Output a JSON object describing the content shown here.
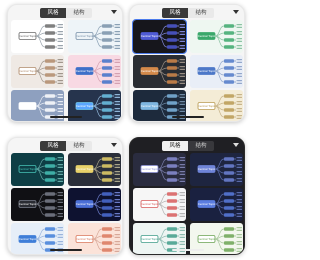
{
  "panels": [
    {
      "id": "top-left",
      "theme": "light",
      "tabs": [
        {
          "label": "风格",
          "active": true
        },
        {
          "label": "结构",
          "active": false
        }
      ],
      "thumbnails": [
        {
          "bg": "#ffffff",
          "accent": "#6a6a6a",
          "center": "#ffffff",
          "line": "#9aa4ad",
          "selected": false,
          "label": "Central Topic"
        },
        {
          "bg": "#eef4f8",
          "accent": "#7890a8",
          "center": "#eef4f8",
          "line": "#8aa0b4",
          "selected": false,
          "label": "Central Topic"
        },
        {
          "bg": "#efe9e4",
          "accent": "#b08a6a",
          "center": "#ffffff",
          "line": "#a0968c",
          "selected": false,
          "label": "Central Topic"
        },
        {
          "bg": "#f8d9e3",
          "accent": "#3e70c9",
          "center": "#3e70c9",
          "line": "#d4a0b0",
          "selected": false,
          "label": "Central Topic"
        },
        {
          "bg": "#8ea0bf",
          "accent": "#ffffff",
          "center": "#ffffff",
          "line": "#e8ecf4",
          "selected": false,
          "label": "Central Topic"
        },
        {
          "bg": "#26344d",
          "accent": "#6fc6e8",
          "center": "#5aa6ff",
          "line": "#8fb5d8",
          "selected": false,
          "label": "Central Topic"
        }
      ]
    },
    {
      "id": "top-right",
      "theme": "light",
      "tabs": [
        {
          "label": "风格",
          "active": true
        },
        {
          "label": "结构",
          "active": false
        }
      ],
      "thumbnails": [
        {
          "bg": "#16161c",
          "accent": "#4f5bd5",
          "center": "#4f5bd5",
          "line": "#7f86d8",
          "selected": true,
          "label": "Central Topic"
        },
        {
          "bg": "#eef7f1",
          "accent": "#3aa86b",
          "center": "#3aa86b",
          "line": "#8cc3a4",
          "selected": false,
          "label": "Central Topic"
        },
        {
          "bg": "#2a2d33",
          "accent": "#d48a4b",
          "center": "#d48a4b",
          "line": "#9a8f84",
          "selected": false,
          "label": "Central Topic"
        },
        {
          "bg": "#e9eef7",
          "accent": "#4d78c8",
          "center": "#4d78c8",
          "line": "#93a8cc",
          "selected": false,
          "label": "Central Topic"
        },
        {
          "bg": "#1d2a3c",
          "accent": "#7fb6e0",
          "center": "#7fb6e0",
          "line": "#6f8aa6",
          "selected": false,
          "label": "Central Topic"
        },
        {
          "bg": "#f4ecd6",
          "accent": "#b99a52",
          "center": "#ffffff",
          "line": "#c7b48a",
          "selected": false,
          "label": "Central Topic"
        }
      ]
    },
    {
      "id": "bottom-left",
      "theme": "light",
      "tabs": [
        {
          "label": "风格",
          "active": true
        },
        {
          "label": "结构",
          "active": false
        }
      ],
      "thumbnails": [
        {
          "bg": "#0e3e45",
          "accent": "#47c2b7",
          "center": "#0e3e45",
          "line": "#62a9a6",
          "selected": false,
          "label": "Central Topic"
        },
        {
          "bg": "#2b2f3a",
          "accent": "#e9d26a",
          "center": "#e9d26a",
          "line": "#a9a58a",
          "selected": false,
          "label": "Central Topic"
        },
        {
          "bg": "#101014",
          "accent": "#7a7f8c",
          "center": "#2a2c33",
          "line": "#6b6f7a",
          "selected": false,
          "label": "Central Topic"
        },
        {
          "bg": "#0e1230",
          "accent": "#4b6fd6",
          "center": "#4b6fd6",
          "line": "#6b7cc8",
          "selected": false,
          "label": "Central Topic"
        },
        {
          "bg": "#e6eef8",
          "accent": "#3f7ed8",
          "center": "#3f7ed8",
          "line": "#9ab5dc",
          "selected": false,
          "label": "Central Topic"
        },
        {
          "bg": "#fbe3d9",
          "accent": "#d9775b",
          "center": "#ffffff",
          "line": "#d8a898",
          "selected": false,
          "label": "Central Topic"
        }
      ]
    },
    {
      "id": "bottom-right",
      "theme": "dark",
      "tabs": [
        {
          "label": "风格",
          "active": true
        },
        {
          "label": "结构",
          "active": false
        }
      ],
      "thumbnails": [
        {
          "bg": "#2a2c3f",
          "accent": "#8a8fd6",
          "center": "#ffffff",
          "line": "#7a7eab",
          "selected": false,
          "label": "Central Topic"
        },
        {
          "bg": "#1e2540",
          "accent": "#6f84d8",
          "center": "#6f84d8",
          "line": "#5a6aa8",
          "selected": false,
          "label": "Central Topic"
        },
        {
          "bg": "#f6f6f6",
          "accent": "#d75a5a",
          "center": "#ffffff",
          "line": "#b5b5b5",
          "selected": false,
          "label": "Central Topic"
        },
        {
          "bg": "#1a2140",
          "accent": "#5b7de0",
          "center": "#5b7de0",
          "line": "#5a6aa8",
          "selected": false,
          "label": "Central Topic"
        },
        {
          "bg": "#eef5f3",
          "accent": "#3e9c88",
          "center": "#ffffff",
          "line": "#8cbab0",
          "selected": false,
          "label": "Central Topic"
        },
        {
          "bg": "#f3f7ee",
          "accent": "#6aa352",
          "center": "#ffffff",
          "line": "#a8c79c",
          "selected": false,
          "label": "Central Topic"
        }
      ]
    }
  ]
}
